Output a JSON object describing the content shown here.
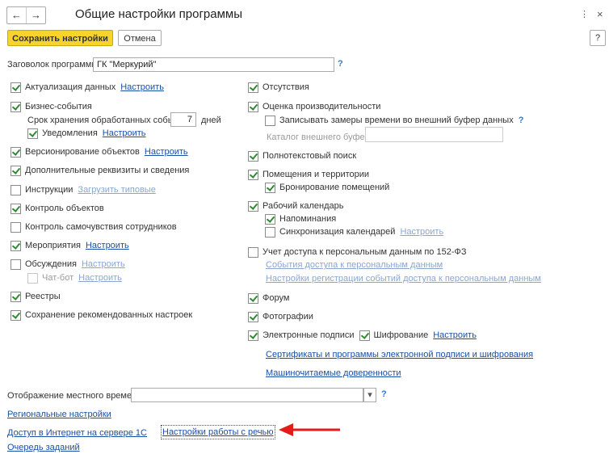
{
  "header": {
    "title": "Общие настройки программы",
    "back_icon": "←",
    "forward_icon": "→",
    "more_icon": "⋮",
    "close_icon": "×"
  },
  "toolbar": {
    "save_label": "Сохранить настройки",
    "cancel_label": "Отмена",
    "help_label": "?"
  },
  "title_field": {
    "label": "Заговолок программы:",
    "value": "ГК \"Меркурий\"",
    "help": "?"
  },
  "left": {
    "actualization": {
      "label": "Актуализация данных",
      "link": "Настроить",
      "checked": true
    },
    "business_events": {
      "label": "Бизнес-события",
      "checked": true
    },
    "retention": {
      "label": "Срок хранения обработанных событий:",
      "value": "7",
      "unit": "дней"
    },
    "notifications": {
      "label": "Уведомления",
      "link": "Настроить",
      "checked": true
    },
    "versioning": {
      "label": "Версионирование объектов",
      "link": "Настроить",
      "checked": true
    },
    "extra_attrs": {
      "label": "Дополнительные реквизиты и сведения",
      "checked": true
    },
    "instructions": {
      "label": "Инструкции",
      "link": "Загрузить типовые",
      "checked": false
    },
    "object_control": {
      "label": "Контроль объектов",
      "checked": true
    },
    "wellbeing": {
      "label": "Контроль самочувствия сотрудников",
      "checked": false
    },
    "events": {
      "label": "Мероприятия",
      "link": "Настроить",
      "checked": true
    },
    "discussions": {
      "label": "Обсуждения",
      "link": "Настроить",
      "checked": false
    },
    "chatbot": {
      "label": "Чат-бот",
      "link": "Настроить",
      "checked": false
    },
    "registers": {
      "label": "Реестры",
      "checked": true
    },
    "recommended": {
      "label": "Сохранение рекомендованных настроек",
      "checked": true
    }
  },
  "right": {
    "absences": {
      "label": "Отсутствия",
      "checked": true
    },
    "performance": {
      "label": "Оценка производительности",
      "checked": true
    },
    "buffer_record": {
      "label": "Записывать замеры времени во внешний буфер данных",
      "checked": false,
      "help": "?"
    },
    "buffer_catalog": {
      "label": "Каталог внешнего буфера:",
      "value": ""
    },
    "fulltext": {
      "label": "Полнотекстовый поиск",
      "checked": true
    },
    "premises": {
      "label": "Помещения и территории",
      "checked": true
    },
    "booking": {
      "label": "Бронирование помещений",
      "checked": true
    },
    "calendar": {
      "label": "Рабочий календарь",
      "checked": true
    },
    "reminders": {
      "label": "Напоминания",
      "checked": true
    },
    "calendar_sync": {
      "label": "Синхронизация календарей",
      "link": "Настроить",
      "checked": false
    },
    "pd_access": {
      "label": "Учет доступа к персональным данным по 152-ФЗ",
      "checked": false
    },
    "pd_events_link": "События доступа к персональным данным",
    "pd_settings_link": "Настройки регистрации событий доступа к персональным данным",
    "forum": {
      "label": "Форум",
      "checked": true
    },
    "photos": {
      "label": "Фотографии",
      "checked": true
    },
    "esign": {
      "label": "Электронные подписи",
      "checked": true
    },
    "encryption": {
      "label": "Шифрование",
      "link": "Настроить",
      "checked": true
    },
    "certs_link": "Сертификаты и программы электронной подписи и шифрования",
    "poa_link": "Машиночитаемые доверенности"
  },
  "bottom": {
    "local_time_label": "Отображение местного времени:",
    "local_time_value": "",
    "local_time_help": "?",
    "dropdown_icon": "▾",
    "regional_link": "Региональные настройки",
    "internet_link": "Доступ в Интернет на сервере 1С",
    "speech_link": "Настройки работы с речью",
    "jobs_link": "Очередь заданий"
  },
  "colors": {
    "accent": "#f6d42d",
    "link": "#1a4fa6",
    "check": "#2e8b32",
    "annotation_arrow": "#e31b1b"
  }
}
